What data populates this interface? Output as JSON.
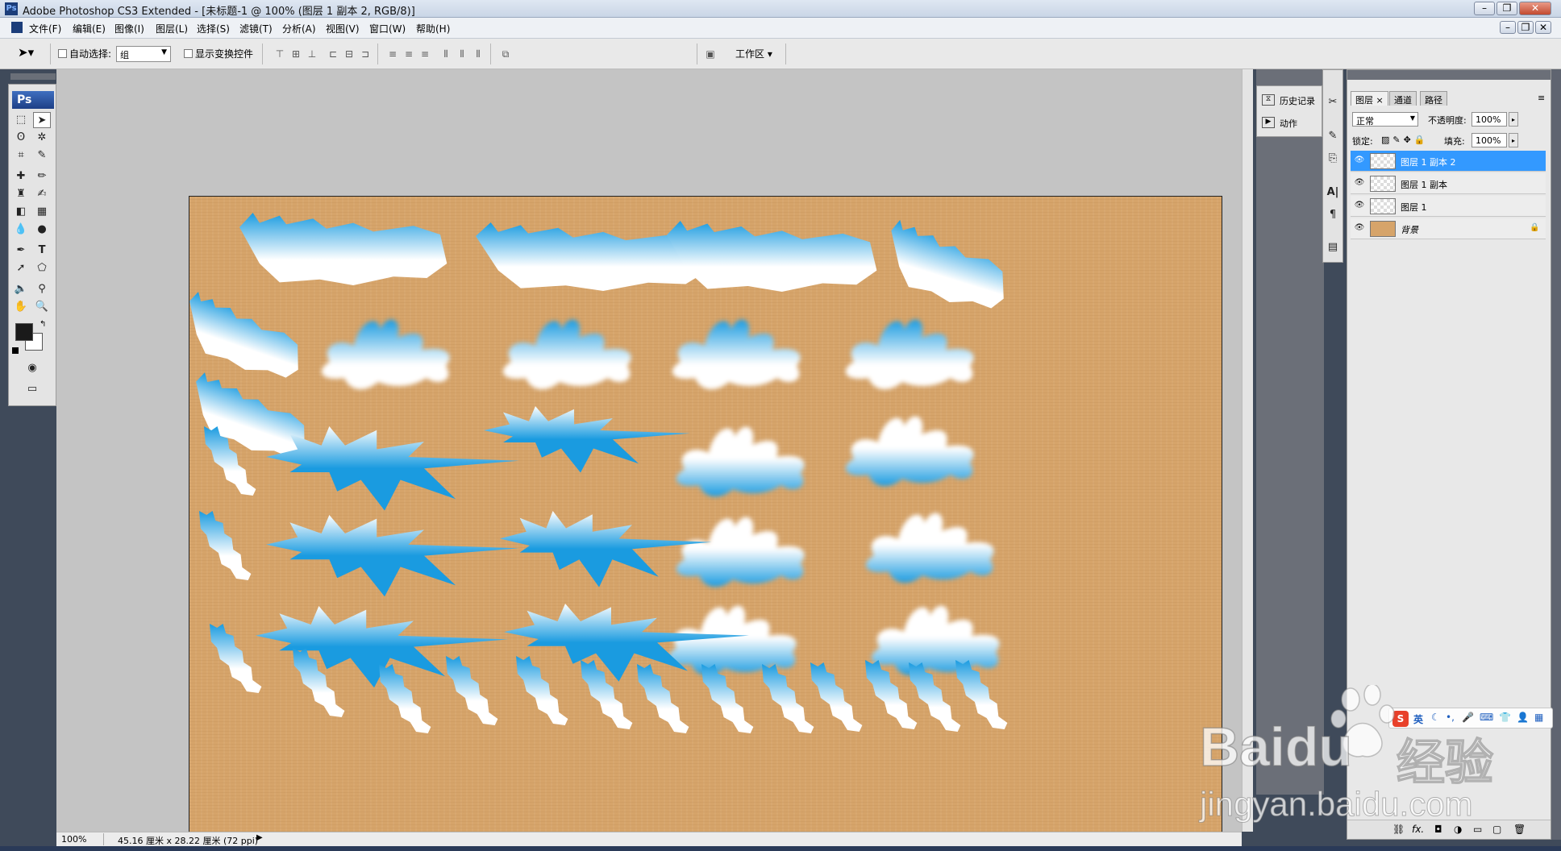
{
  "window": {
    "title": "Adobe Photoshop CS3 Extended - [未标题-1 @ 100% (图层 1 副本 2, RGB/8)]",
    "app_icon": "Ps",
    "controls": [
      "minimize-icon",
      "restore-icon",
      "close-icon"
    ]
  },
  "menubar": {
    "items": [
      "文件(F)",
      "编辑(E)",
      "图像(I)",
      "图层(L)",
      "选择(S)",
      "滤镜(T)",
      "分析(A)",
      "视图(V)",
      "窗口(W)",
      "帮助(H)"
    ]
  },
  "options": {
    "auto_select_label": "自动选择:",
    "auto_select_value": "组",
    "show_transform_label": "显示变换控件",
    "workspace_label": "工作区 ▾"
  },
  "toolbox": {
    "badge": "Ps",
    "tools": [
      "marquee-icon",
      "move-icon",
      "lasso-icon",
      "magic-wand-icon",
      "crop-icon",
      "slice-icon",
      "healing-icon",
      "brush-icon",
      "stamp-icon",
      "history-brush-icon",
      "eraser-icon",
      "gradient-icon",
      "blur-icon",
      "dodge-icon",
      "pen-icon",
      "type-icon",
      "path-select-icon",
      "shape-icon",
      "notes-icon",
      "eyedropper-icon",
      "hand-icon",
      "zoom-icon"
    ],
    "text_tool_glyph": "T",
    "colors": {
      "foreground": "#1a1a1a",
      "background": "#ffffff"
    }
  },
  "canvas": {
    "background_color": "#d6a46a",
    "shape_colors": {
      "top": "#1a9be0",
      "bottom": "#ffffff"
    }
  },
  "statusbar": {
    "zoom": "100%",
    "doc_info": "45.16 厘米 x 28.22 厘米 (72 ppi)"
  },
  "history_panel": {
    "items": [
      {
        "icon": "history-icon",
        "label": "历史记录"
      },
      {
        "icon": "actions-icon",
        "label": "动作"
      }
    ]
  },
  "side_tools": [
    "tools-icon",
    "brush-presets-icon",
    "clone-source-icon",
    "character-icon",
    "paragraph-icon",
    "layer-comps-icon"
  ],
  "side_tool_glyphs": {
    "character": "A|",
    "paragraph": "¶"
  },
  "layers_panel": {
    "tabs": [
      "图层",
      "通道",
      "路径"
    ],
    "blend_mode": "正常",
    "opacity_label": "不透明度:",
    "opacity_value": "100%",
    "lock_label": "锁定:",
    "fill_label": "填充:",
    "fill_value": "100%",
    "layers": [
      {
        "name": "图层 1 副本 2",
        "selected": true
      },
      {
        "name": "图层 1 副本",
        "selected": false
      },
      {
        "name": "图层 1",
        "selected": false
      },
      {
        "name": "背景",
        "selected": false,
        "locked": true
      }
    ],
    "footer_icons": [
      "link-icon",
      "fx-icon",
      "mask-icon",
      "adjustment-icon",
      "folder-icon",
      "new-layer-icon",
      "trash-icon"
    ],
    "footer_fx_text": "fx."
  },
  "ime": {
    "logo": "S",
    "lang": "英",
    "icons": [
      "moon-icon",
      "punctuation-icon",
      "mic-icon",
      "keyboard-icon",
      "shirt-icon",
      "user-icon",
      "grid-icon"
    ]
  },
  "watermark": {
    "brand": "Baidu",
    "brand_cn": "经验",
    "url": "jingyan.baidu.com"
  }
}
